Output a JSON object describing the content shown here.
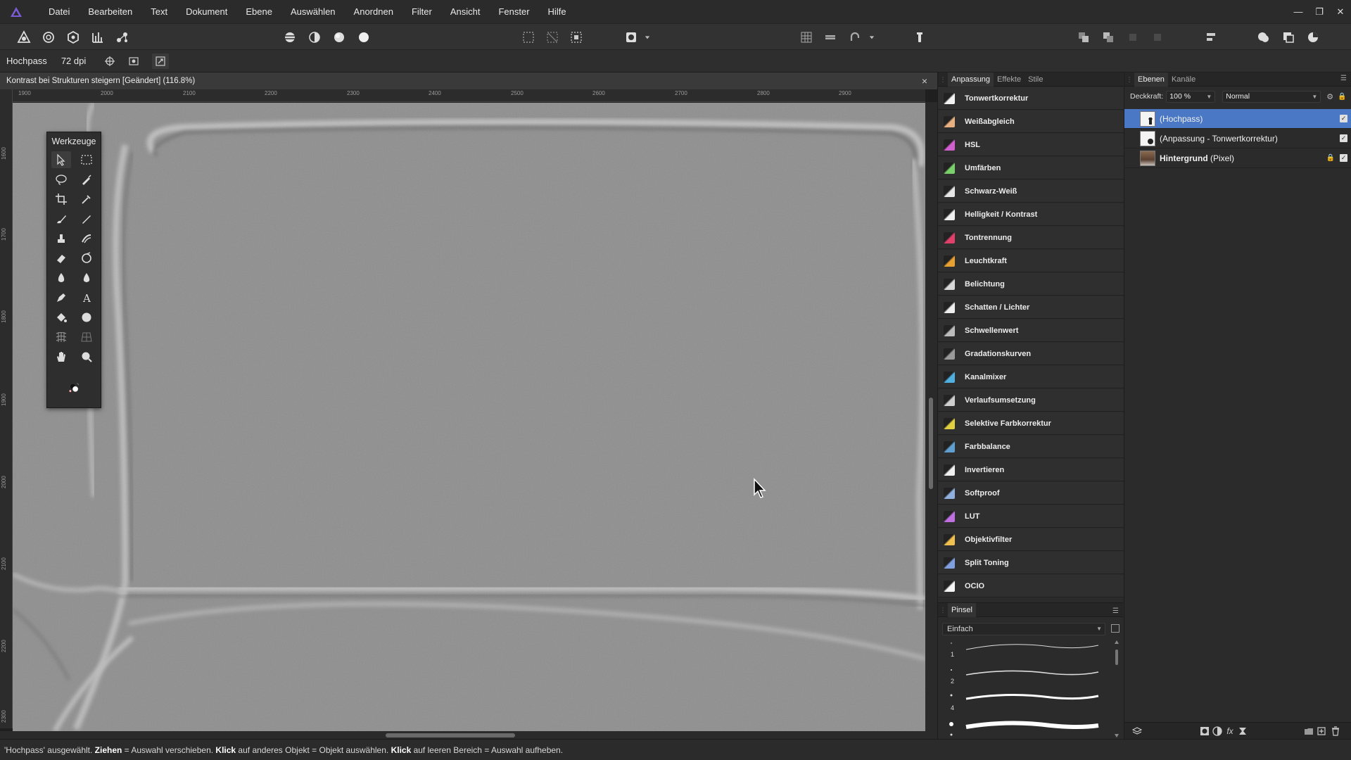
{
  "menu": {
    "items": [
      "Datei",
      "Bearbeiten",
      "Text",
      "Dokument",
      "Ebene",
      "Auswählen",
      "Anordnen",
      "Filter",
      "Ansicht",
      "Fenster",
      "Hilfe"
    ]
  },
  "context": {
    "layer_type": "Hochpass",
    "dpi": "72 dpi"
  },
  "document": {
    "title": "Kontrast bei Strukturen steigern [Geändert] (116.8%)",
    "close_symbol": "×",
    "ruler_h": [
      "1900",
      "2000",
      "2100",
      "2200",
      "2300",
      "2400",
      "2500",
      "2600",
      "2700",
      "2800",
      "2900"
    ],
    "ruler_v": [
      "1600",
      "1700",
      "1800",
      "1900",
      "2000",
      "2100",
      "2200",
      "2300"
    ]
  },
  "tools": {
    "title": "Werkzeuge"
  },
  "adjustment_panel": {
    "tabs": [
      "Anpassung",
      "Effekte",
      "Stile"
    ],
    "items": [
      {
        "label": "Tonwertkorrektur",
        "color": "#f2f2f2"
      },
      {
        "label": "Weißabgleich",
        "color": "#e8b080"
      },
      {
        "label": "HSL",
        "color": "#d25fd0"
      },
      {
        "label": "Umfärben",
        "color": "#7ad06a"
      },
      {
        "label": "Schwarz-Weiß",
        "color": "#e6e6e6"
      },
      {
        "label": "Helligkeit / Kontrast",
        "color": "#f0f0f0"
      },
      {
        "label": "Tontrennung",
        "color": "#e0406a"
      },
      {
        "label": "Leuchtkraft",
        "color": "#e8a030"
      },
      {
        "label": "Belichtung",
        "color": "#d8d8d8"
      },
      {
        "label": "Schatten / Lichter",
        "color": "#eeeeee"
      },
      {
        "label": "Schwellenwert",
        "color": "#bdbdbd"
      },
      {
        "label": "Gradationskurven",
        "color": "#9a9a9a"
      },
      {
        "label": "Kanalmixer",
        "color": "#50b0e0"
      },
      {
        "label": "Verlaufsumsetzung",
        "color": "#cfcfcf"
      },
      {
        "label": "Selektive Farbkorrektur",
        "color": "#e0d040"
      },
      {
        "label": "Farbbalance",
        "color": "#60a0d0"
      },
      {
        "label": "Invertieren",
        "color": "#f0f0f0"
      },
      {
        "label": "Softproof",
        "color": "#90b0e0"
      },
      {
        "label": "LUT",
        "color": "#c070e0"
      },
      {
        "label": "Objektivfilter",
        "color": "#f0c050"
      },
      {
        "label": "Split Toning",
        "color": "#80a0e0"
      },
      {
        "label": "OCIO",
        "color": "#f5f5f5"
      }
    ]
  },
  "brush_panel": {
    "title": "Pinsel",
    "category": "Einfach",
    "sizes": [
      "1",
      "2",
      "4"
    ]
  },
  "layers_panel": {
    "tabs": [
      "Ebenen",
      "Kanäle"
    ],
    "opacity_label": "Deckkraft:",
    "opacity_value": "100 %",
    "blend_mode": "Normal",
    "layers": [
      {
        "name": "(Hochpass)",
        "selected": true
      },
      {
        "name": "(Anpassung - Tonwertkorrektur)",
        "selected": false
      },
      {
        "name_bold": "Hintergrund",
        "name_suffix": " (Pixel)",
        "selected": false
      }
    ]
  },
  "status": {
    "prefix": "'Hochpass' ausgewählt. ",
    "k1": "Ziehen",
    "t1": " = Auswahl verschieben. ",
    "k2": "Klick",
    "t2": " auf anderes Objekt = Objekt auswählen. ",
    "k3": "Klick",
    "t3": " auf leeren Bereich = Auswahl aufheben."
  },
  "colors": {
    "accent": "#4a78c4",
    "app_logo": "#7b5cd6",
    "canvas_gray": "#8c8c8c"
  }
}
